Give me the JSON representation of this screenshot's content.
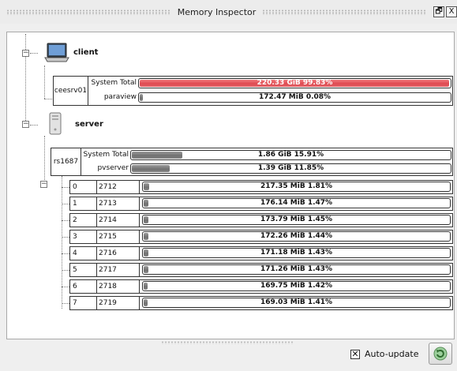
{
  "window": {
    "title": "Memory Inspector",
    "float_icon": "float-window-icon",
    "close_icon": "close-icon",
    "float_glyph": "🗗",
    "close_glyph": "X"
  },
  "colors": {
    "red_fill": "#df4a51",
    "gray_fill": "#7a7a7a"
  },
  "client": {
    "label": "client",
    "icon": "laptop-icon",
    "host": "ceesrv01",
    "rows": [
      {
        "label": "System Total",
        "text": "220.33 GiB 99.83%",
        "fraction": 0.9983,
        "color": "red"
      },
      {
        "label": "paraview",
        "text": "172.47 MiB 0.08%",
        "fraction": 0.0008,
        "color": "gray"
      }
    ]
  },
  "server": {
    "label": "server",
    "icon": "server-icon",
    "host": "rs1687",
    "rows": [
      {
        "label": "System Total",
        "text": "1.86 GiB 15.91%",
        "fraction": 0.1591,
        "color": "gray"
      },
      {
        "label": "pvserver",
        "text": "1.39 GiB 11.85%",
        "fraction": 0.1185,
        "color": "gray"
      }
    ],
    "processes": [
      {
        "index": "0",
        "pid": "2712",
        "text": "217.35 MiB 1.81%",
        "fraction": 0.0181
      },
      {
        "index": "1",
        "pid": "2713",
        "text": "176.14 MiB 1.47%",
        "fraction": 0.0147
      },
      {
        "index": "2",
        "pid": "2714",
        "text": "173.79 MiB 1.45%",
        "fraction": 0.0145
      },
      {
        "index": "3",
        "pid": "2715",
        "text": "172.26 MiB 1.44%",
        "fraction": 0.0144
      },
      {
        "index": "4",
        "pid": "2716",
        "text": "171.18 MiB 1.43%",
        "fraction": 0.0143
      },
      {
        "index": "5",
        "pid": "2717",
        "text": "171.26 MiB 1.43%",
        "fraction": 0.0143
      },
      {
        "index": "6",
        "pid": "2718",
        "text": "169.75 MiB 1.42%",
        "fraction": 0.0142
      },
      {
        "index": "7",
        "pid": "2719",
        "text": "169.03 MiB 1.41%",
        "fraction": 0.0141
      }
    ]
  },
  "footer": {
    "auto_update_label": "Auto-update",
    "auto_update_checked": true,
    "refresh_icon": "refresh-icon"
  }
}
